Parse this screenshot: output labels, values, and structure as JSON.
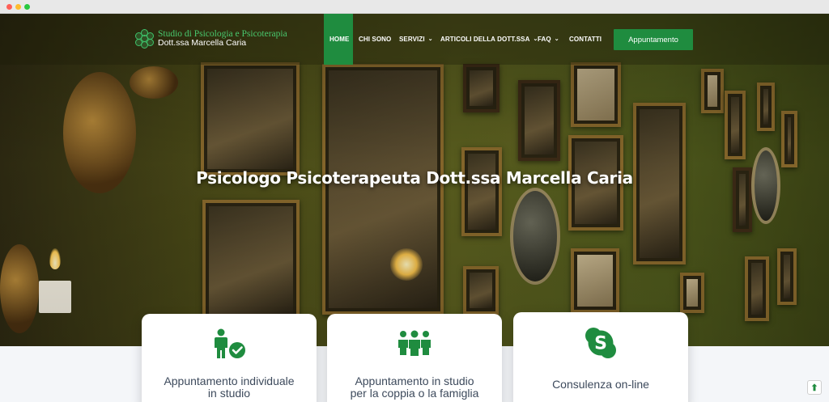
{
  "brand": {
    "line1": "Studio di Psicologia e Psicoterapia",
    "line2": "Dott.ssa Marcella Caria"
  },
  "nav": {
    "home": "HOME",
    "chi_sono": "CHI SONO",
    "servizi": "SERVIZI",
    "articoli": "ARTICOLI DELLA DOTT.SSA",
    "faq": "FAQ",
    "contatti": "CONTATTI",
    "chevron": "⌄",
    "cta": "Appuntamento"
  },
  "hero": {
    "title": "Psicologo Psicoterapeuta Dott.ssa Marcella Caria"
  },
  "cards": [
    {
      "icon": "person-check-icon",
      "label_line1": "Appuntamento individuale",
      "label_line2": "in studio"
    },
    {
      "icon": "group-icon",
      "label_line1": "Appuntamento in studio",
      "label_line2": "per la coppia o la famiglia"
    },
    {
      "icon": "skype-icon",
      "label_line1": "Consulenza on-line",
      "label_line2": ""
    }
  ],
  "scroll_top": {
    "icon": "arrow-up-icon",
    "glyph": "⬆"
  },
  "colors": {
    "brand_green": "#1f8c3f",
    "logo_green": "#48c96e",
    "card_text": "#3d4a5c"
  }
}
